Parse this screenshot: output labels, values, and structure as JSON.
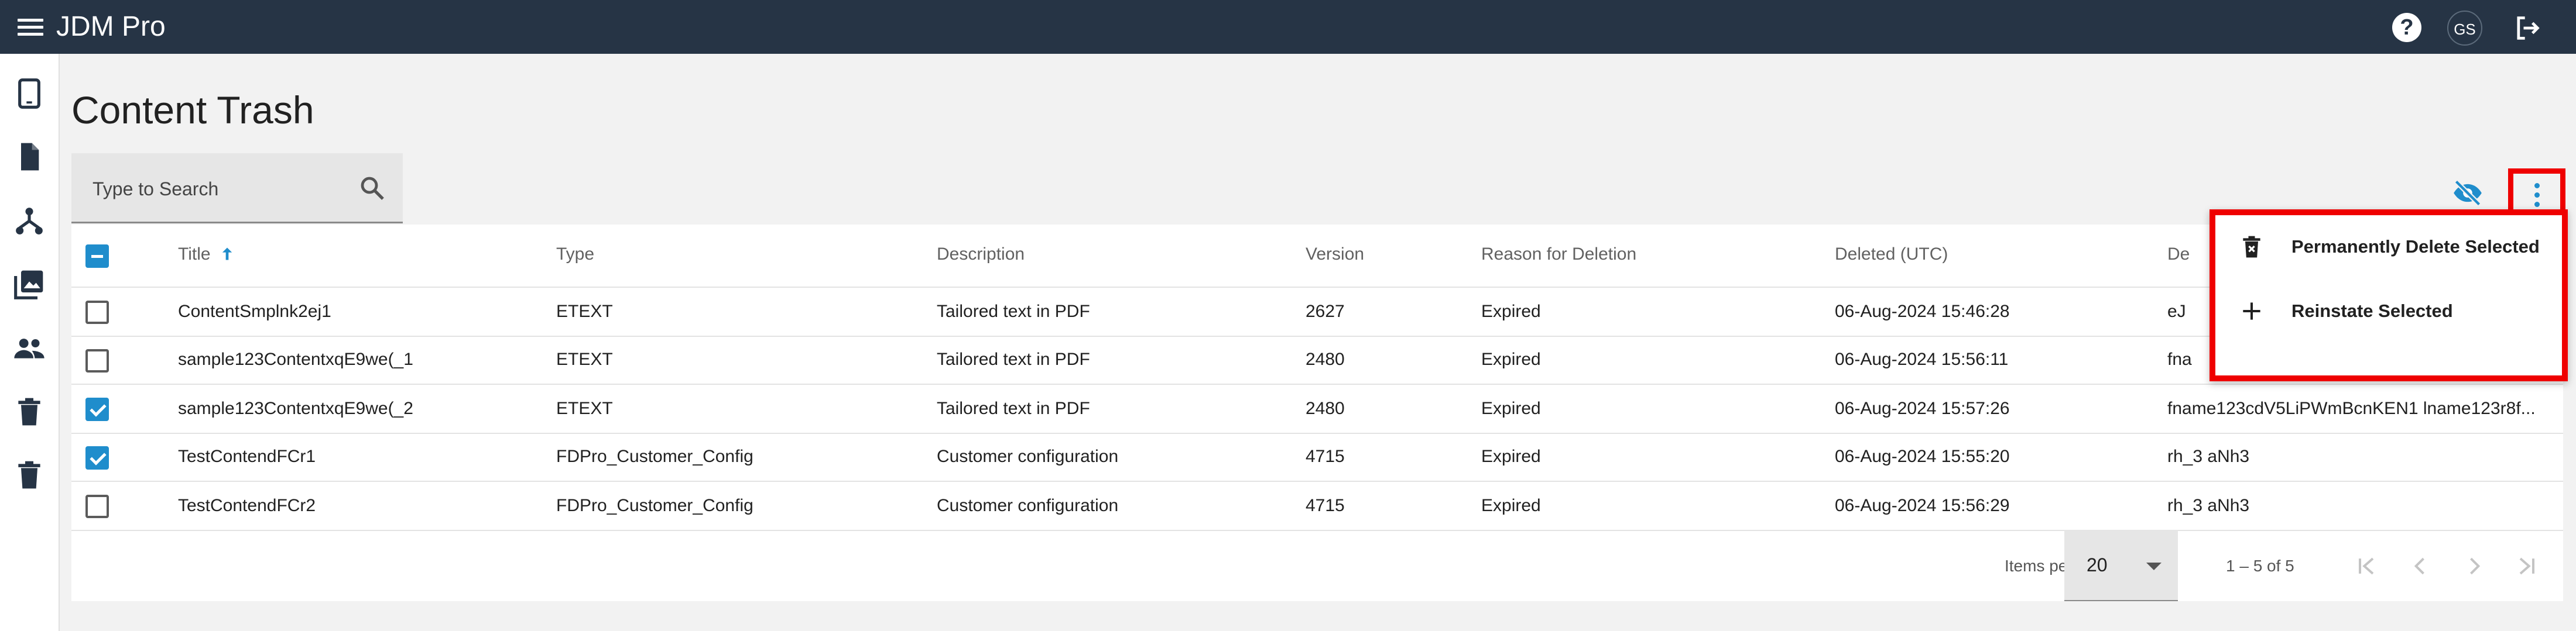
{
  "app": {
    "title": "JDM Pro",
    "user_initials": "GS"
  },
  "page": {
    "title": "Content Trash"
  },
  "search": {
    "placeholder": "Type to Search",
    "value": ""
  },
  "colors": {
    "topbar": "#263445",
    "accent": "#1f8dcc",
    "highlight": "#ef0000"
  },
  "sidebar": {
    "items": [
      {
        "icon": "tablet-icon"
      },
      {
        "icon": "document-icon"
      },
      {
        "icon": "hierarchy-icon"
      },
      {
        "icon": "photo-library-icon"
      },
      {
        "icon": "people-icon"
      },
      {
        "icon": "trash-icon"
      },
      {
        "icon": "trash-icon"
      }
    ]
  },
  "table": {
    "sort": {
      "column": "Title",
      "direction": "ascending"
    },
    "header_checkbox": "indeterminate",
    "columns": [
      "Title",
      "Type",
      "Description",
      "Version",
      "Reason for Deletion",
      "Deleted (UTC)",
      "De"
    ],
    "rows": [
      {
        "selected": false,
        "cells": [
          "ContentSmplnk2ej1",
          "ETEXT",
          "Tailored text in PDF",
          "2627",
          "Expired",
          "06-Aug-2024 15:46:28",
          "eJ"
        ]
      },
      {
        "selected": false,
        "cells": [
          "sample123ContentxqE9we(_1",
          "ETEXT",
          "Tailored text in PDF",
          "2480",
          "Expired",
          "06-Aug-2024 15:56:11",
          "fna"
        ]
      },
      {
        "selected": true,
        "cells": [
          "sample123ContentxqE9we(_2",
          "ETEXT",
          "Tailored text in PDF",
          "2480",
          "Expired",
          "06-Aug-2024 15:57:26",
          "fname123cdV5LiPWmBcnKEN1 lname123r8f..."
        ]
      },
      {
        "selected": true,
        "cells": [
          "TestContendFCr1",
          "FDPro_Customer_Config",
          "Customer configuration",
          "4715",
          "Expired",
          "06-Aug-2024 15:55:20",
          "rh_3 aNh3"
        ]
      },
      {
        "selected": false,
        "cells": [
          "TestContendFCr2",
          "FDPro_Customer_Config",
          "Customer configuration",
          "4715",
          "Expired",
          "06-Aug-2024 15:56:29",
          "rh_3 aNh3"
        ]
      }
    ]
  },
  "paginator": {
    "items_per_page_label": "Items per page:",
    "page_size": "20",
    "range_label": "1 – 5 of 5"
  },
  "context_menu": {
    "items": [
      {
        "label": "Permanently Delete Selected",
        "icon": "delete-forever-icon"
      },
      {
        "label": "Reinstate Selected",
        "icon": "plus-icon"
      }
    ]
  }
}
